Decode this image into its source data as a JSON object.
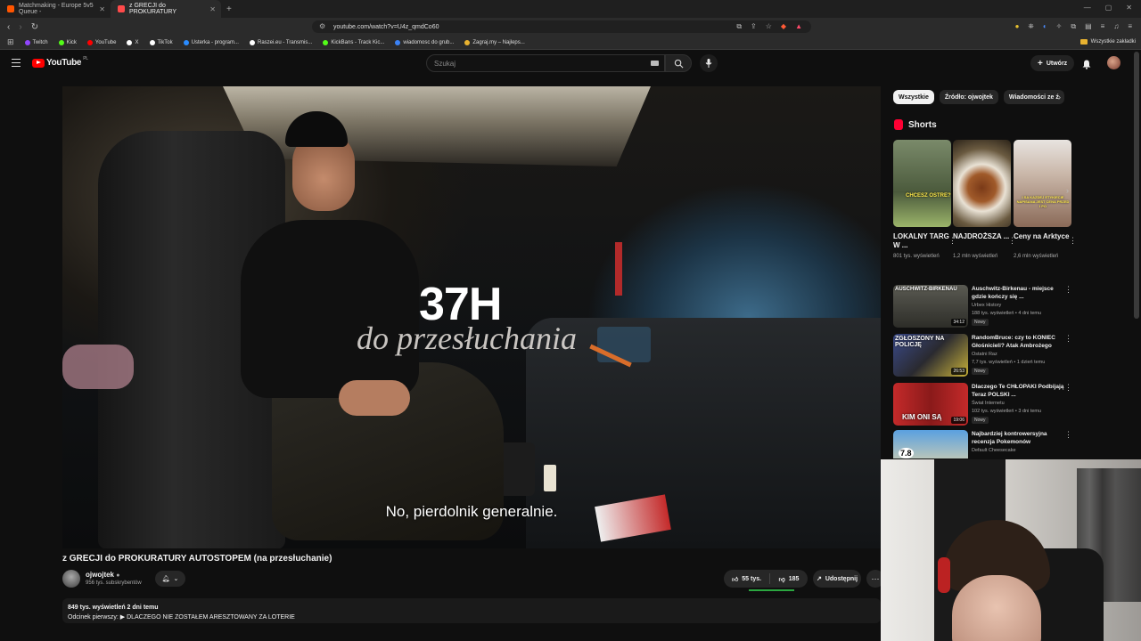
{
  "browser": {
    "tabs": [
      {
        "label": "Matchmaking - Europe 5v5 Queue -"
      },
      {
        "label": "z GRECJI do PROKURATURY"
      }
    ],
    "url": "youtube.com/watch?v=U4z_qmdCo60",
    "bookmarks": [
      {
        "label": "Twitch",
        "color": "#9146ff"
      },
      {
        "label": "Kick",
        "color": "#53fc18"
      },
      {
        "label": "YouTube",
        "color": "#ff0000"
      },
      {
        "label": "X",
        "color": "#ffffff"
      },
      {
        "label": "TikTok",
        "color": "#ffffff"
      },
      {
        "label": "Usterka - program...",
        "color": "#2a8cff"
      },
      {
        "label": "Raszei.eu - Transmis...",
        "color": "#ffffff"
      },
      {
        "label": "KickBans - Track Kic...",
        "color": "#53fc18"
      },
      {
        "label": "wiadomosc do grub...",
        "color": "#3b82f6"
      },
      {
        "label": "Zagraj.my – Najleps...",
        "color": "#e8b230"
      }
    ],
    "bookmarks_folder": "Wszystkie zakładki"
  },
  "youtube": {
    "logo_text": "YouTube",
    "logo_region": "PL",
    "search_placeholder": "Szukaj",
    "create_label": "Utwórz"
  },
  "video": {
    "overlay_title": "37H",
    "overlay_subtitle": "do przesłuchania",
    "caption": "No, pierdolnik generalnie.",
    "title": "z GRECJI do PROKURATURY AUTOSTOPEM (na przesłuchanie)",
    "channel": "ojwojtek",
    "subscribers": "956 tys. subskrybentów",
    "likes": "55 tys.",
    "dislikes": "185",
    "share_label": "Udostępnij",
    "like_ratio": 0.99,
    "description_meta": "849 tys. wyświetleń  2 dni temu",
    "description_line": "Odcinek pierwszy: ▶ DLACZEGO NIE ZOSTAŁEM ARESZTOWANY ZA LOTERIE"
  },
  "sidebar": {
    "chips": [
      "Wszystkie",
      "Źródło: ojwojtek",
      "Wiadomości ze ź"
    ],
    "shorts_label": "Shorts",
    "shorts": [
      {
        "title": "LOKALNY TARG W ...",
        "views": "801 tys. wyświetleń",
        "thumb_text": "CHCESZ OSTRE?"
      },
      {
        "title": "NAJDROŻSZA ...",
        "views": "1,2 mln wyświetleń",
        "thumb_text": ""
      },
      {
        "title": "Ceny na Arktyce",
        "views": "2,6 mln wyświetleń",
        "thumb_text": "I SA KAZDEJ ETYKIECIE NAPISANA JEST CENA PRZED I PO"
      }
    ],
    "recommended": [
      {
        "title": "Auschwitz-Birkenau - miejsce gdzie kończy się ...",
        "channel": "Urbex History",
        "stats": "188 tys. wyświetleń • 4 dni temu",
        "badge": "Nowy",
        "duration": "34:12",
        "thumb_text": "AUSCHWITZ-BIRKENAU"
      },
      {
        "title": "RandomBruce: czy to KONIEC Głośnicieli? Atak Ambrożego",
        "channel": "Ostatni Raz",
        "stats": "7,7 tys. wyświetleń • 1 dzień temu",
        "badge": "Nowy",
        "duration": "26:53",
        "thumb_text": "ZGŁOSZONY NA POLICJĘ"
      },
      {
        "title": "Dlaczego Te CHŁOPAKI Podbijają Teraz POLSKI ...",
        "channel": "Świat Internetu",
        "stats": "102 tys. wyświetleń • 3 dni temu",
        "badge": "Nowy",
        "duration": "19:06",
        "thumb_text": "KIM ONI SĄ"
      },
      {
        "title": "Najbardziej kontrowersyjna recenzja Pokemonów",
        "channel": "Default Cheesecake",
        "stats": "",
        "badge": "",
        "duration": "",
        "thumb_text": "7.8"
      }
    ]
  }
}
